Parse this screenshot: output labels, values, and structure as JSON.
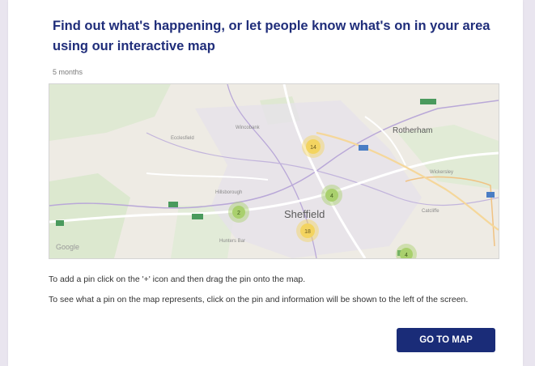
{
  "header": {
    "title": "Find out what's happening, or let people know what's on in your area using our interactive map",
    "meta": "5 months"
  },
  "map": {
    "labels": {
      "city": "Sheffield",
      "town_ne": "Rotherham",
      "place_1": "Wincobank",
      "place_2": "Ecclesfield",
      "place_3": "Wickersley",
      "place_4": "Catcliffe",
      "place_5": "Hillsborough",
      "place_6": "Hunters Bar"
    },
    "clusters": [
      {
        "count": "14",
        "color": "#f3d460"
      },
      {
        "count": "4",
        "color": "#a9d06d"
      },
      {
        "count": "2",
        "color": "#a9d06d"
      },
      {
        "count": "18",
        "color": "#f3d460"
      },
      {
        "count": "4",
        "color": "#a9d06d"
      }
    ],
    "attribution": "Google"
  },
  "instructions": {
    "line1": "To add a pin click on the '+' icon and then drag the pin onto the map.",
    "line2": "To see what a pin on the map represents, click on the pin and information will be shown to the left of the screen."
  },
  "cta": {
    "label": "GO TO MAP"
  },
  "colors": {
    "title": "#1f2d7a",
    "button": "#1a2c78",
    "cluster_yellow": "#f3d460",
    "cluster_green": "#a9d06d"
  }
}
